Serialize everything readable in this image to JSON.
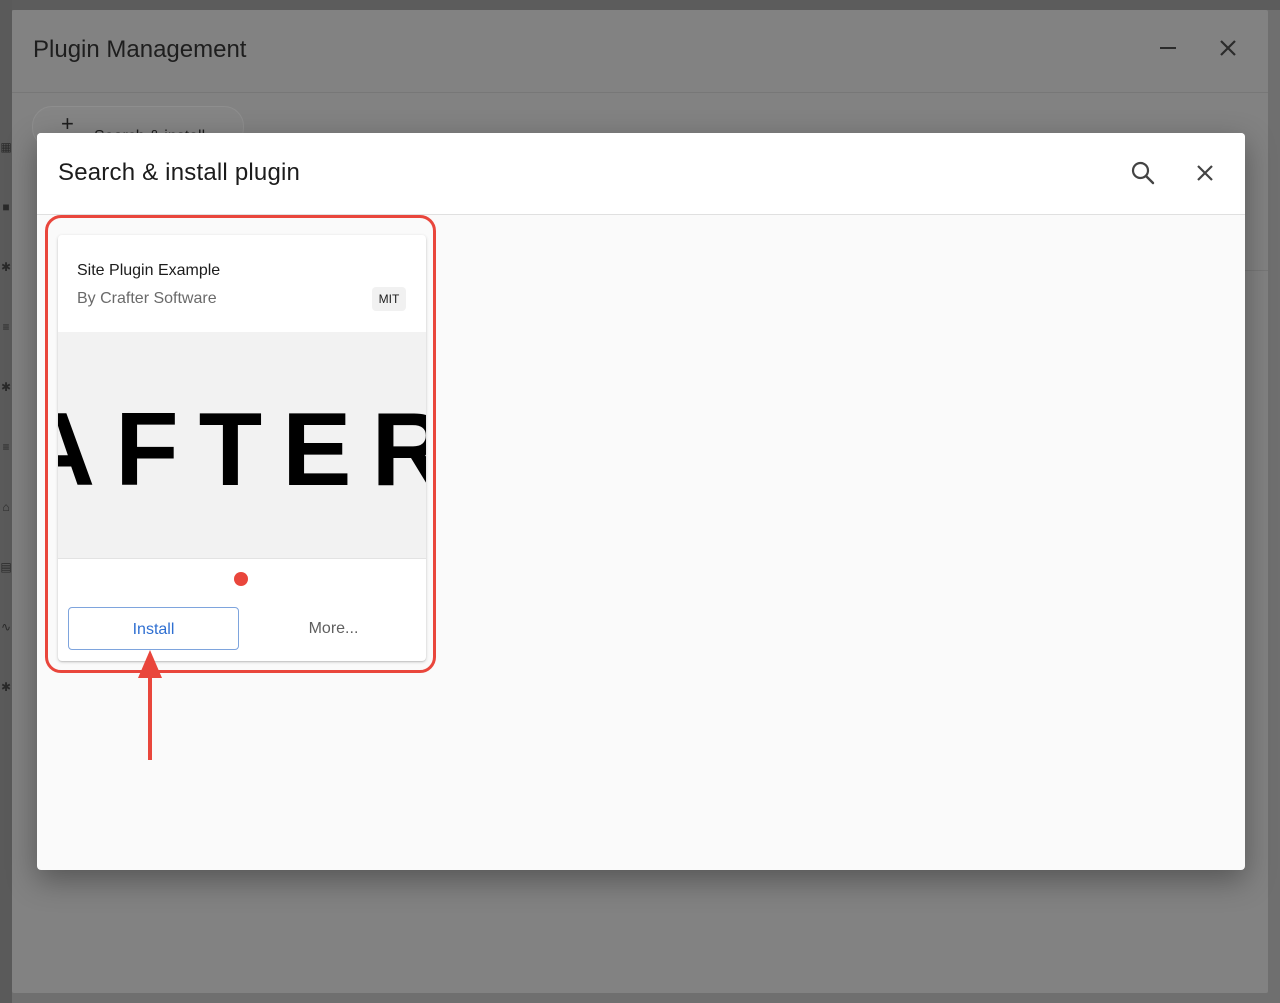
{
  "plugin_management": {
    "title": "Plugin Management",
    "search_install_label": "Search & install"
  },
  "search_install_dialog": {
    "title": "Search & install plugin"
  },
  "plugin_card": {
    "name": "Site Plugin Example",
    "author": "By Crafter Software",
    "license": "MIT",
    "image_text": "AFTER",
    "install_label": "Install",
    "more_label": "More..."
  },
  "annotation": {
    "color": "#e9463c"
  },
  "colors": {
    "accent_blue": "#2f6fd1",
    "overlay_gray": "#6f6f6f"
  }
}
